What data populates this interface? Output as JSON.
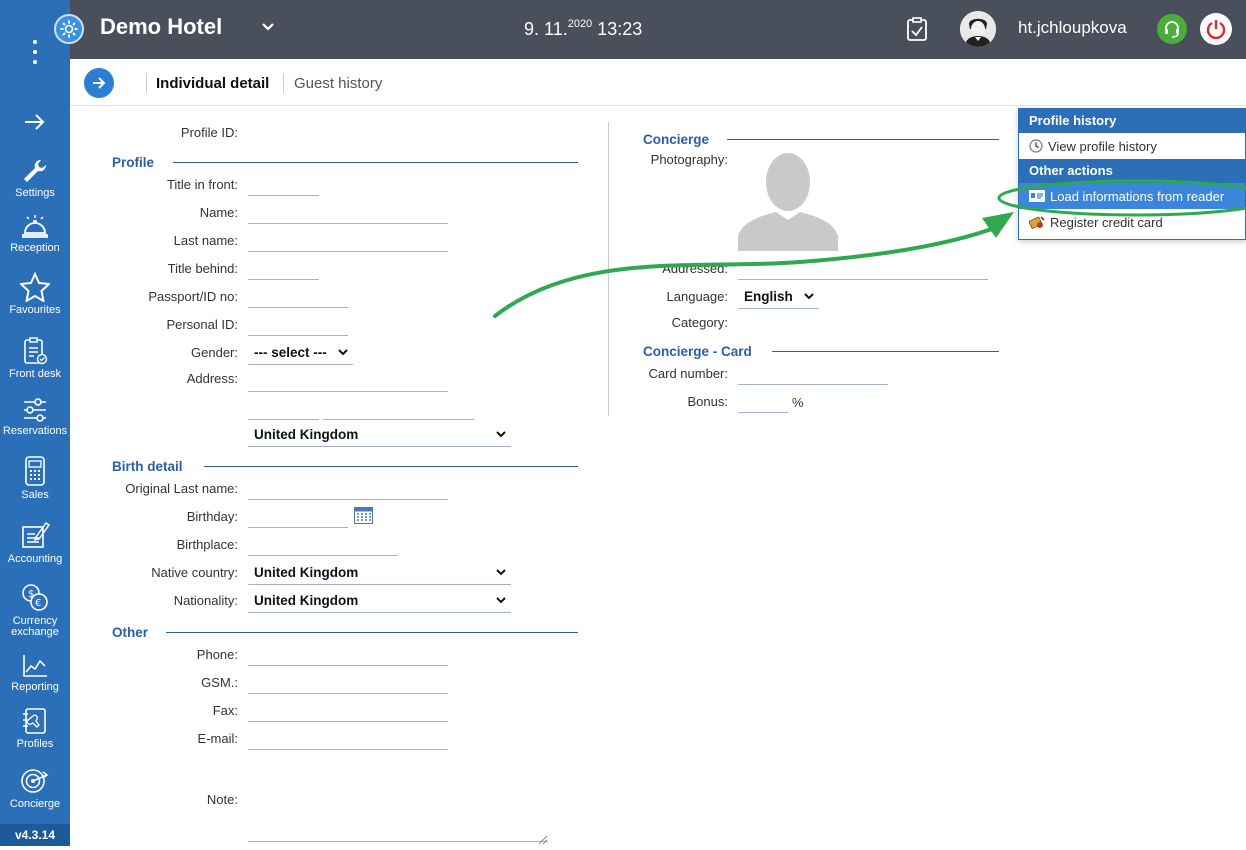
{
  "app": {
    "hotel_name": "Demo Hotel",
    "date": "9. 11.",
    "year": "2020",
    "time": "13:23",
    "username": "ht.jchloupkova",
    "version": "v4.3.14"
  },
  "sidebar": {
    "items": [
      {
        "label": "Settings",
        "icon": "wrench-icon"
      },
      {
        "label": "Reception",
        "icon": "bell-icon"
      },
      {
        "label": "Favourites",
        "icon": "star-icon"
      },
      {
        "label": "Front desk",
        "icon": "clipboard-icon"
      },
      {
        "label": "Reservations",
        "icon": "sliders-icon"
      },
      {
        "label": "Sales",
        "icon": "calculator-icon"
      },
      {
        "label": "Accounting",
        "icon": "ledger-icon"
      },
      {
        "label": "Currency exchange",
        "icon": "currency-icon"
      },
      {
        "label": "Reporting",
        "icon": "chart-icon"
      },
      {
        "label": "Profiles",
        "icon": "profiles-icon"
      },
      {
        "label": "Concierge",
        "icon": "target-icon"
      }
    ]
  },
  "tabs": {
    "individual": "Individual detail",
    "guest_history": "Guest history"
  },
  "form": {
    "profile_id_label": "Profile ID:",
    "profile_section": "Profile",
    "title_front_label": "Title in front:",
    "name_label": "Name:",
    "last_name_label": "Last name:",
    "title_behind_label": "Title behind:",
    "passport_label": "Passport/ID no:",
    "personal_id_label": "Personal ID:",
    "gender_label": "Gender:",
    "gender_value": "--- select ---",
    "address_label": "Address:",
    "address_country": "United Kingdom",
    "birth_section": "Birth detail",
    "original_last_name_label": "Original Last name:",
    "birthday_label": "Birthday:",
    "birthplace_label": "Birthplace:",
    "native_country_label": "Native country:",
    "native_country_value": "United Kingdom",
    "nationality_label": "Nationality:",
    "nationality_value": "United Kingdom",
    "other_section": "Other",
    "phone_label": "Phone:",
    "gsm_label": "GSM.:",
    "fax_label": "Fax:",
    "email_label": "E-mail:",
    "note_label": "Note:",
    "concierge_section": "Concierge",
    "photography_label": "Photography:",
    "addressed_label": "Addressed:",
    "language_label": "Language:",
    "language_value": "English",
    "category_label": "Category:",
    "card_section": "Concierge - Card",
    "card_number_label": "Card number:",
    "bonus_label": "Bonus:",
    "bonus_unit": "%"
  },
  "menu": {
    "profile_history_header": "Profile history",
    "view_profile_history": "View profile history",
    "other_actions_header": "Other actions",
    "load_from_reader": "Load informations from reader",
    "register_credit_card": "Register credit card"
  },
  "colors": {
    "sidebar": "#2a6fb8",
    "topbar": "#4a4f5c",
    "accent": "#2a5ea8",
    "highlight": "#2fa84f"
  }
}
